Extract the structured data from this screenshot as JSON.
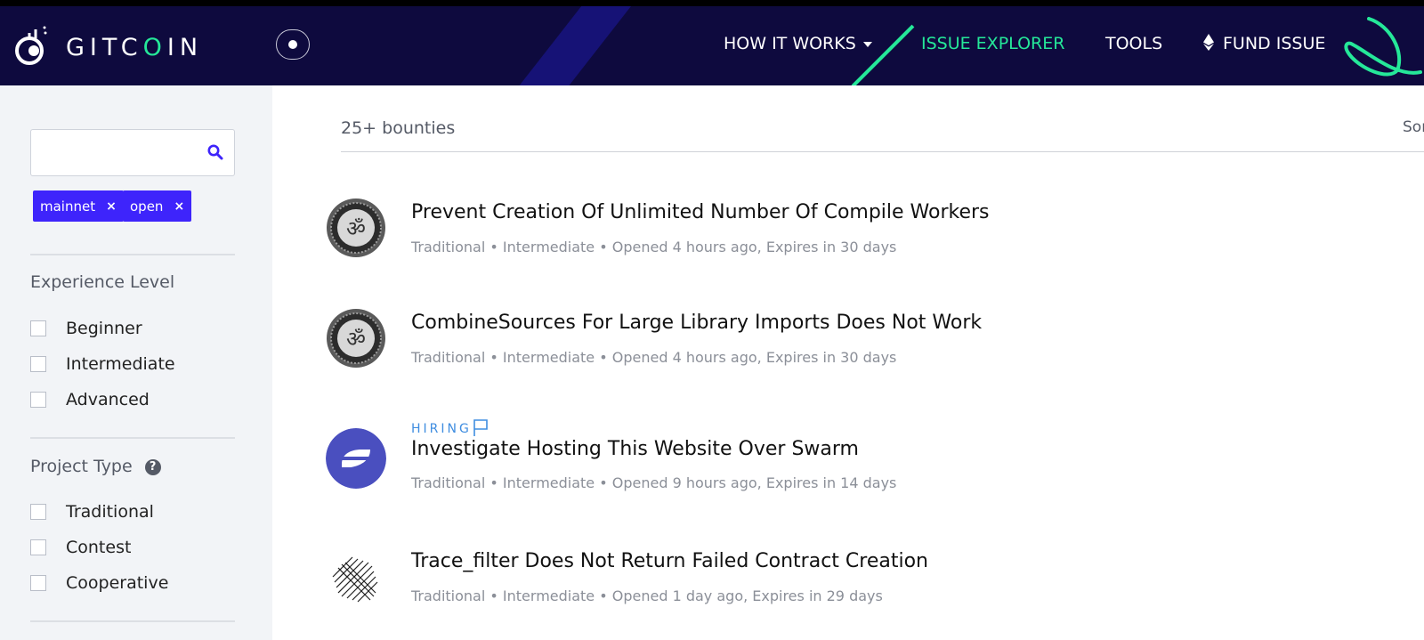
{
  "header": {
    "logo_text_pre": "GITC",
    "logo_text_o": "O",
    "logo_text_post": "IN",
    "nav": {
      "how_it_works": "HOW IT WORKS",
      "issue_explorer": "ISSUE EXPLORER",
      "tools": "TOOLS",
      "fund_issue": "FUND ISSUE"
    },
    "accent_color": "#25e899",
    "nav_bg": "#0e0a3e"
  },
  "sidebar": {
    "search": {
      "value": "",
      "placeholder": ""
    },
    "chips": [
      "mainnet",
      "open"
    ],
    "chip_remove": "×",
    "experience": {
      "title": "Experience Level",
      "options": [
        "Beginner",
        "Intermediate",
        "Advanced"
      ]
    },
    "project_type": {
      "title": "Project Type",
      "help": "?",
      "options": [
        "Traditional",
        "Contest",
        "Cooperative"
      ]
    },
    "chip_color": "#3e24fb"
  },
  "main": {
    "count": "25+ bounties",
    "sort_label": "Sort",
    "bounties": [
      {
        "title": "Prevent Creation Of Unlimited Number Of Compile Workers",
        "meta": "Traditional • Intermediate • Opened 4 hours ago, Expires in 30 days",
        "avatar_icon": "om-coin-icon",
        "hiring": ""
      },
      {
        "title": "CombineSources For Large Library Imports Does Not Work",
        "meta": "Traditional • Intermediate • Opened 4 hours ago, Expires in 30 days",
        "avatar_icon": "om-coin-icon",
        "hiring": ""
      },
      {
        "title": "Investigate Hosting This Website Over Swarm",
        "meta": "Traditional • Intermediate • Opened 9 hours ago, Expires in 14 days",
        "avatar_icon": "swarm-logo-icon",
        "hiring": "HIRING"
      },
      {
        "title": "Trace_filter Does Not Return Failed Contract Creation",
        "meta": "Traditional • Intermediate • Opened 1 day ago, Expires in 29 days",
        "avatar_icon": "striped-diamond-icon",
        "hiring": ""
      }
    ]
  }
}
